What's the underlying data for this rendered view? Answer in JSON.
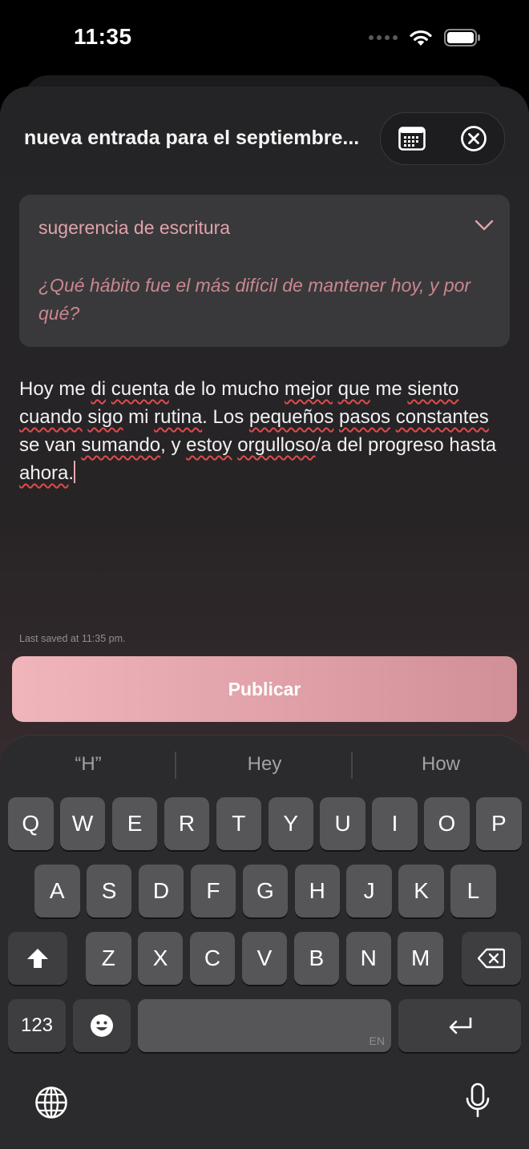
{
  "status_bar": {
    "time": "11:35"
  },
  "header": {
    "title": "nueva entrada para el septiembre...",
    "calendar_icon": "calendar-icon",
    "close_icon": "close-circle-icon"
  },
  "prompt": {
    "label": "sugerencia de escritura",
    "question": "¿Qué hábito fue el más difícil de mantener hoy, y por qué?"
  },
  "entry": {
    "text": "Hoy me di cuenta de lo mucho mejor que me siento cuando sigo mi rutina. Los pequeños pasos constantes se van sumando, y estoy orgulloso/a del progreso hasta ahora.",
    "last_saved": "Last saved at 11:35 pm."
  },
  "publish_button": {
    "label": "Publicar"
  },
  "keyboard": {
    "suggestions": [
      "“H”",
      "Hey",
      "How"
    ],
    "row1": [
      "Q",
      "W",
      "E",
      "R",
      "T",
      "Y",
      "U",
      "I",
      "O",
      "P"
    ],
    "row2": [
      "A",
      "S",
      "D",
      "F",
      "G",
      "H",
      "J",
      "K",
      "L"
    ],
    "row3": [
      "Z",
      "X",
      "C",
      "V",
      "B",
      "N",
      "M"
    ],
    "numbers_label": "123",
    "language_hint": "EN"
  }
}
